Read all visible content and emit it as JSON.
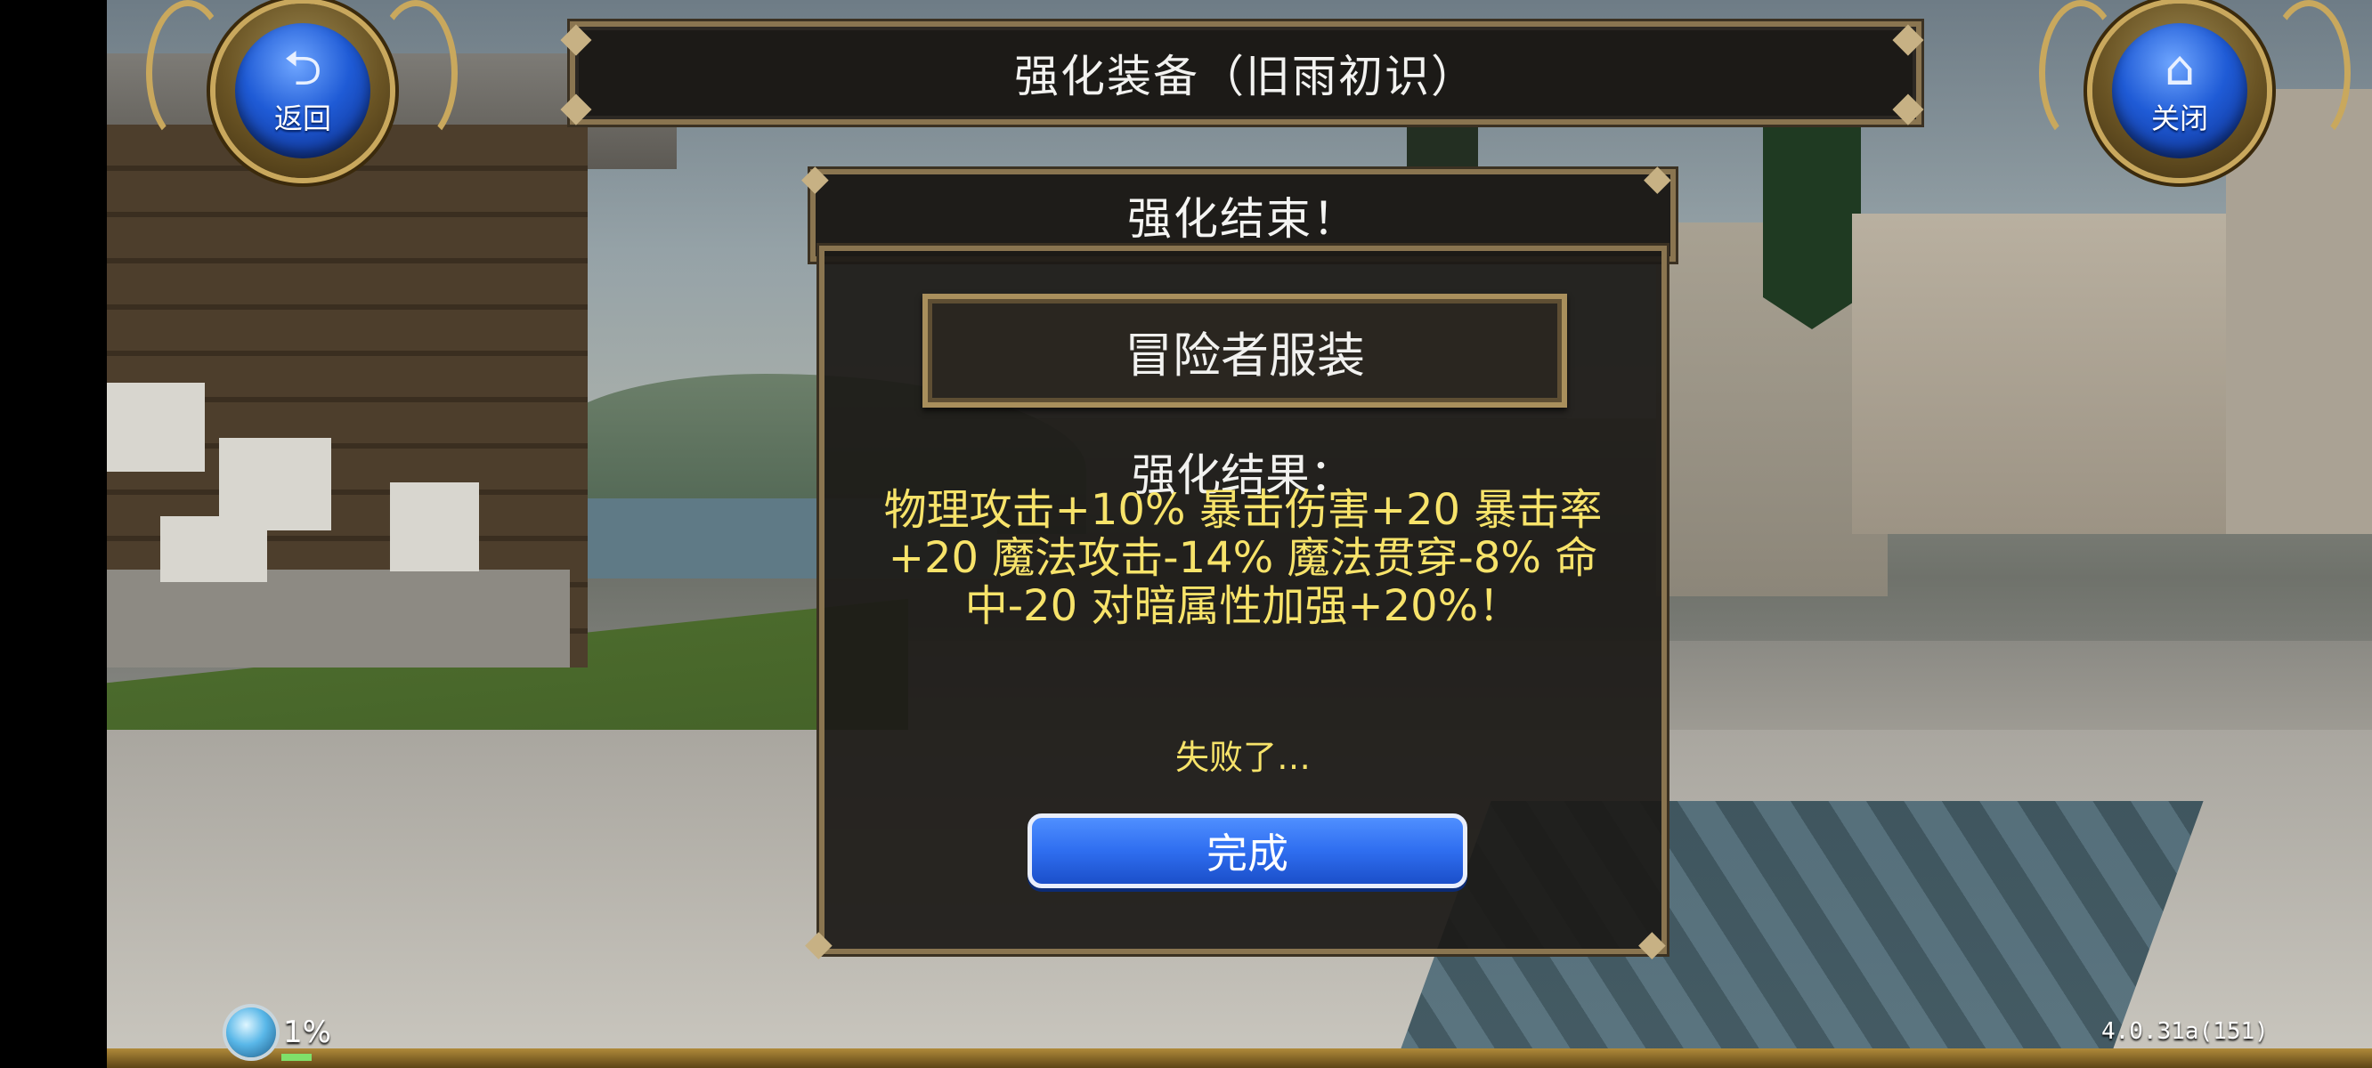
{
  "header": {
    "title": "强化装备（旧雨初识）",
    "back_label": "返回",
    "back_icon": "return-arrow-icon",
    "close_label": "关闭",
    "close_icon": "home-icon"
  },
  "dialog": {
    "title": "强化结束！",
    "item_name": "冒险者服装",
    "result_label": "强化结果：",
    "result_text": "物理攻击+10% 暴击伤害+20 暴击率+20 魔法攻击-14% 魔法贯穿-8% 命中-20 对暗属性加强+20%！",
    "status_text": "失败了…",
    "done_label": "完成"
  },
  "hud": {
    "progress_percent": "1%",
    "progress_value": 0.01,
    "version": "4.0.31a(151)"
  },
  "colors": {
    "result_text": "#f7e36a",
    "button_blue": "#2f6ef0",
    "frame_gold": "#8a7550"
  }
}
